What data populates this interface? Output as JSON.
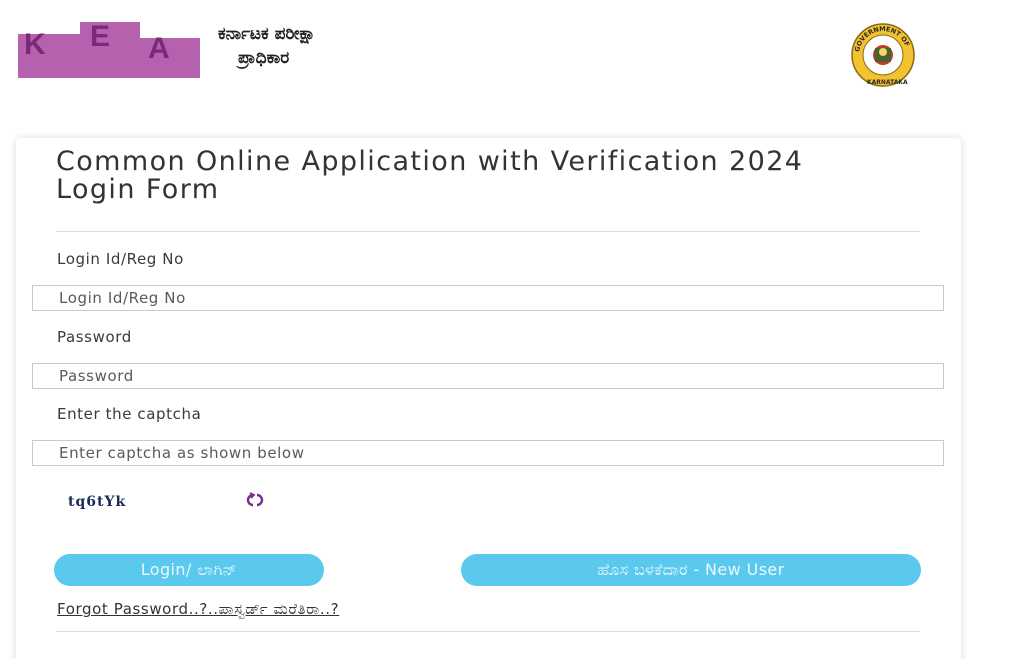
{
  "header": {
    "logo_letters": [
      "K",
      "E",
      "A"
    ],
    "title_line1": "ಕರ್ನಾಟಕ ಪರೀಕ್ಷಾ",
    "title_line2": "ಪ್ರಾಧಿಕಾರ",
    "seal_top_text": "GOVERNMENT OF",
    "seal_bottom_text": "KARNATAKA",
    "logo_color": "#a0449a",
    "logo_step_color": "#b561ad"
  },
  "form": {
    "title": "Common Online Application with Verification 2024 Login Form",
    "login_label": "Login Id/Reg No",
    "login_placeholder": "Login Id/Reg No",
    "password_label": "Password",
    "password_placeholder": "Password",
    "captcha_label": "Enter the captcha",
    "captcha_placeholder": "Enter captcha as shown below",
    "captcha_value": "tq6tYk",
    "refresh_icon": "refresh-icon",
    "login_button": "Login/ ಲಾಗಿನ್",
    "new_user_button": "ಹೊಸ ಬಳಕೆದಾರ - New User",
    "forgot_link": "Forgot Password..?..ಪಾಸ್ವರ್ಡ್ ಮರೆತಿರಾ..?",
    "button_color": "#5bc8ee"
  }
}
